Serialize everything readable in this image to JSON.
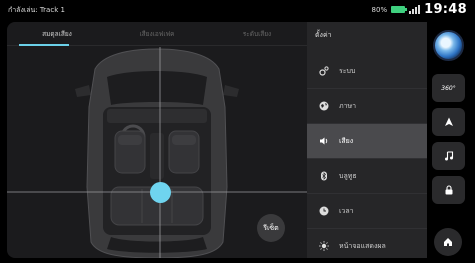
{
  "status_bar": {
    "now_playing": "กำลังเล่น: Track 1",
    "battery_percent": "80%",
    "time": "19:48",
    "colors": {
      "battery": "#3fd07f"
    }
  },
  "sound_panel": {
    "tabs": [
      {
        "label": "สมดุลเสียง",
        "active": true
      },
      {
        "label": "เสียงเอฟเฟค",
        "active": false
      },
      {
        "label": "ระดับเสียง",
        "active": false
      }
    ],
    "reset_label": "รีเซ็ต",
    "balance_point_color": "#6fd4ef"
  },
  "settings": {
    "title": "ตั้งค่า",
    "items": [
      {
        "label": "ระบบ",
        "icon": "system-icon"
      },
      {
        "label": "ภาษา",
        "icon": "language-icon"
      },
      {
        "label": "เสียง",
        "icon": "speaker-icon",
        "active": true
      },
      {
        "label": "บลูทูธ",
        "icon": "bluetooth-icon"
      },
      {
        "label": "เวลา",
        "icon": "clock-icon"
      },
      {
        "label": "หน้าจอแสดงผล",
        "icon": "brightness-icon"
      }
    ]
  },
  "dock": {
    "view_360_label": "360°",
    "buttons": [
      "360-view-icon",
      "navigation-icon",
      "music-icon",
      "lock-icon",
      "home-icon"
    ]
  }
}
